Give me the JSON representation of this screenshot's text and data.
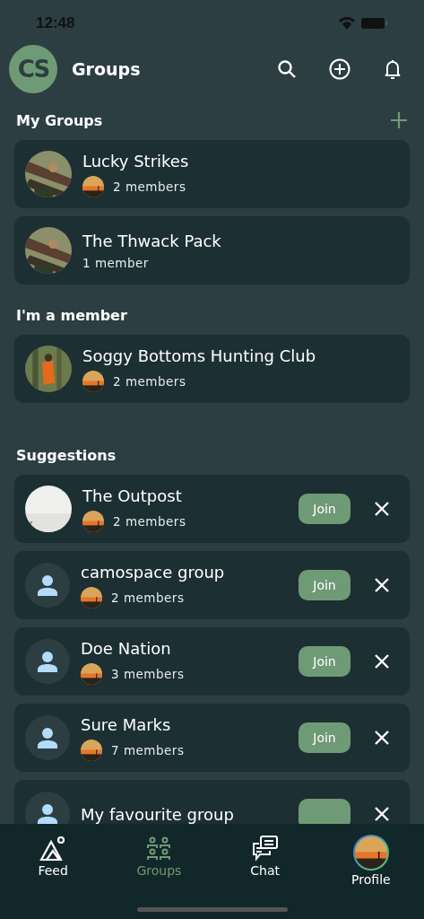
{
  "status_bar": {
    "time": "12:48"
  },
  "header": {
    "logo": "CS",
    "title": "Groups"
  },
  "sections": [
    {
      "title": "My Groups",
      "kind": "list",
      "add_button": true,
      "groups": [
        {
          "name": "Lucky Strikes",
          "kind": "picture",
          "member_avatar": true,
          "members": "2 members"
        },
        {
          "name": "The Thwack Pack",
          "kind": "picture",
          "member_avatar": false,
          "members": "1 member"
        }
      ]
    },
    {
      "title": "I'm a member",
      "kind": "list",
      "add_button": false,
      "groups": [
        {
          "name": "Soggy Bottoms Hunting Club",
          "kind": "picture",
          "member_avatar": true,
          "members": "2 members"
        }
      ]
    },
    {
      "title": "Suggestions",
      "kind": "suggestions",
      "add_button": false,
      "groups": [
        {
          "name": "The Outpost",
          "kind": "picture",
          "member_avatar": true,
          "members": "2 members",
          "join": "Join"
        },
        {
          "name": "camospace group",
          "kind": "placeholder",
          "member_avatar": true,
          "members": "2 members",
          "join": "Join"
        },
        {
          "name": "Doe Nation",
          "kind": "placeholder",
          "member_avatar": true,
          "members": "3 members",
          "join": "Join"
        },
        {
          "name": "Sure Marks",
          "kind": "placeholder",
          "member_avatar": true,
          "members": "7 members",
          "join": "Join"
        },
        {
          "name": "My favourite group",
          "kind": "placeholder",
          "member_avatar": false
        }
      ]
    }
  ],
  "tabs": [
    {
      "label": "Feed",
      "kind": "feed",
      "selected": false
    },
    {
      "label": "Groups",
      "kind": "groups",
      "selected": true
    },
    {
      "label": "Chat",
      "kind": "chat",
      "selected": false
    },
    {
      "label": "Profile",
      "kind": "profile",
      "selected": false
    }
  ]
}
